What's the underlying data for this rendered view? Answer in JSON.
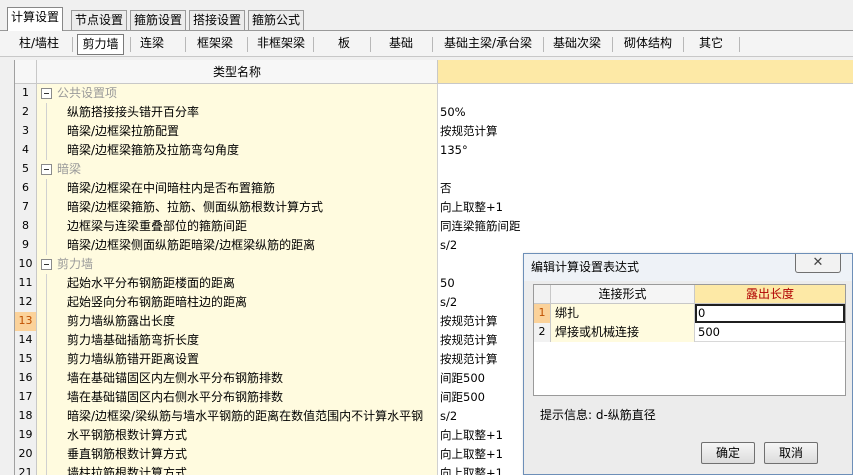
{
  "tabs": [
    {
      "label": "计算设置",
      "active": true
    },
    {
      "label": "节点设置",
      "active": false
    },
    {
      "label": "箍筋设置",
      "active": false
    },
    {
      "label": "搭接设置",
      "active": false
    },
    {
      "label": "箍筋公式",
      "active": false
    }
  ],
  "component_tabs": [
    {
      "label": "柱/墙柱",
      "active": false
    },
    {
      "label": "剪力墙",
      "active": true
    },
    {
      "label": "连梁",
      "active": false
    },
    {
      "label": "框架梁",
      "active": false
    },
    {
      "label": "非框架梁",
      "active": false
    },
    {
      "label": "板",
      "active": false
    },
    {
      "label": "基础",
      "active": false
    },
    {
      "label": "基础主梁/承台梁",
      "active": false
    },
    {
      "label": "基础次梁",
      "active": false
    },
    {
      "label": "砌体结构",
      "active": false
    },
    {
      "label": "其它",
      "active": false
    }
  ],
  "grid": {
    "header_name": "类型名称",
    "header_value": "",
    "rows": [
      {
        "num": "1",
        "group": true,
        "name": "公共设置项",
        "value": ""
      },
      {
        "num": "2",
        "group": false,
        "name": "纵筋搭接接头错开百分率",
        "value": "50%"
      },
      {
        "num": "3",
        "group": false,
        "name": "暗梁/边框梁拉筋配置",
        "value": "按规范计算"
      },
      {
        "num": "4",
        "group": false,
        "name": "暗梁/边框梁箍筋及拉筋弯勾角度",
        "value": "135°"
      },
      {
        "num": "5",
        "group": true,
        "name": "暗梁",
        "value": ""
      },
      {
        "num": "6",
        "group": false,
        "name": "暗梁/边框梁在中间暗柱内是否布置箍筋",
        "value": "否"
      },
      {
        "num": "7",
        "group": false,
        "name": "暗梁/边框梁箍筋、拉筋、侧面纵筋根数计算方式",
        "value": "向上取整+1"
      },
      {
        "num": "8",
        "group": false,
        "name": "边框梁与连梁重叠部位的箍筋间距",
        "value": "同连梁箍筋间距"
      },
      {
        "num": "9",
        "group": false,
        "name": "暗梁/边框梁侧面纵筋距暗梁/边框梁纵筋的距离",
        "value": "s/2"
      },
      {
        "num": "10",
        "group": true,
        "name": "剪力墙",
        "value": ""
      },
      {
        "num": "11",
        "group": false,
        "name": "起始水平分布钢筋距楼面的距离",
        "value": "50"
      },
      {
        "num": "12",
        "group": false,
        "name": "起始竖向分布钢筋距暗柱边的距离",
        "value": "s/2"
      },
      {
        "num": "13",
        "group": false,
        "name": "剪力墙纵筋露出长度",
        "value": "按规范计算",
        "selected": true
      },
      {
        "num": "14",
        "group": false,
        "name": "剪力墙基础插筋弯折长度",
        "value": "按规范计算"
      },
      {
        "num": "15",
        "group": false,
        "name": "剪力墙纵筋错开距离设置",
        "value": "按规范计算"
      },
      {
        "num": "16",
        "group": false,
        "name": "墙在基础锚固区内左侧水平分布钢筋排数",
        "value": "间距500"
      },
      {
        "num": "17",
        "group": false,
        "name": "墙在基础锚固区内右侧水平分布钢筋排数",
        "value": "间距500"
      },
      {
        "num": "18",
        "group": false,
        "name": "暗梁/边框梁/梁纵筋与墙水平钢筋的距离在数值范围内不计算水平钢",
        "value": "s/2"
      },
      {
        "num": "19",
        "group": false,
        "name": "水平钢筋根数计算方式",
        "value": "向上取整+1"
      },
      {
        "num": "20",
        "group": false,
        "name": "垂直钢筋根数计算方式",
        "value": "向上取整+1"
      },
      {
        "num": "21",
        "group": false,
        "name": "墙柱拉筋根数计算方式",
        "value": "向上取整+1"
      }
    ]
  },
  "dialog": {
    "title": "编辑计算设置表达式",
    "close_label": "✕",
    "col_a": "连接形式",
    "col_b": "露出长度",
    "rows": [
      {
        "num": "1",
        "a": "绑扎",
        "b": "0",
        "selected": true
      },
      {
        "num": "2",
        "a": "焊接或机械连接",
        "b": "500",
        "selected": false
      }
    ],
    "hint": "提示信息: d-纵筋直径",
    "ok_label": "确定",
    "cancel_label": "取消"
  }
}
